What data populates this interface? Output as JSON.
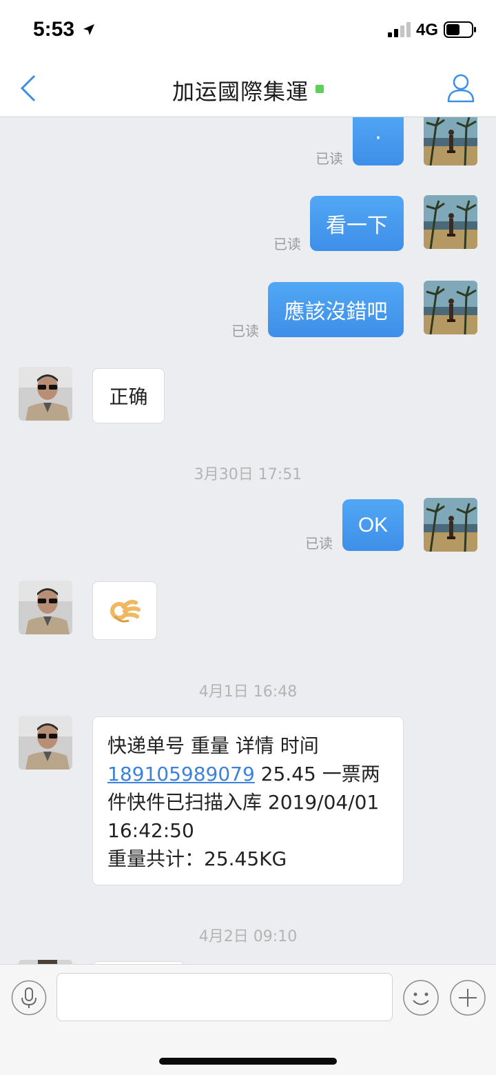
{
  "status_bar": {
    "time": "5:53",
    "network": "4G",
    "icons": [
      "location-arrow-icon",
      "signal-icon",
      "battery-icon"
    ]
  },
  "nav": {
    "title": "加运國際集運",
    "online_color": "#5ecf5a",
    "accent": "#3d8fe8"
  },
  "messages": {
    "m1": {
      "direction": "out",
      "text": "·",
      "status": "已读"
    },
    "m2": {
      "direction": "out",
      "text": "看一下",
      "status": "已读"
    },
    "m3": {
      "direction": "out",
      "text": "應該沒錯吧",
      "status": "已读"
    },
    "m4": {
      "direction": "in",
      "text": "正确"
    },
    "ts1": "3月30日 17:51",
    "m5": {
      "direction": "out",
      "text": "OK",
      "status": "已读"
    },
    "m6": {
      "direction": "in",
      "text": "👌",
      "icon": "ok-hand-icon"
    },
    "ts2": "4月1日 16:48",
    "m7": {
      "direction": "in",
      "line1": "快递单号 重量 详情 时间",
      "tracking_number": "189105989079",
      "line2_rest": " 25.45 一票两",
      "line3": "件快件已扫描入库 2019/04/01",
      "line4": "16:42:50",
      "line5": "重量共计：25.45KG"
    },
    "ts3": "4月2日 09:10"
  },
  "input_bar": {
    "placeholder": "",
    "icons": [
      "microphone-icon",
      "emoji-icon",
      "plus-icon"
    ]
  }
}
